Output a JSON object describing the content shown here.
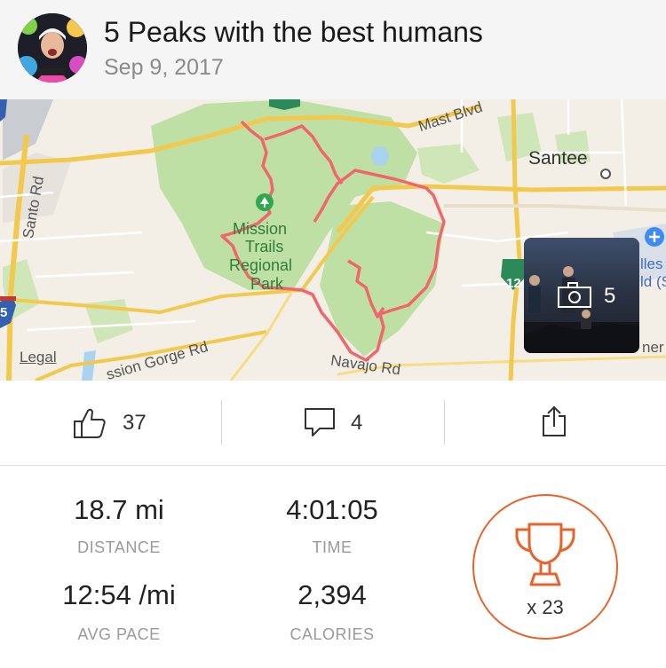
{
  "activity": {
    "title": "5 Peaks with the best humans",
    "date": "Sep 9, 2017"
  },
  "map": {
    "labels": {
      "mast_blvd": "Mast Blvd",
      "santee": "Santee",
      "santo_rd": "Santo Rd",
      "park_line1": "Mission",
      "park_line2": "Trails",
      "park_line3": "Regional",
      "park_line4": "Park",
      "gorge_rd": "ssion Gorge Rd",
      "navajo_rd": "Navajo Rd",
      "right_edge1": "lles",
      "right_edge2": "ld (S",
      "right_edge3": "ner",
      "highway_12": "12",
      "highway_5": "5",
      "legal": "Legal"
    },
    "route_color": "#f0666a",
    "park_color": "#bfe0a5"
  },
  "photos": {
    "count": "5"
  },
  "social": {
    "kudos": "37",
    "comments": "4"
  },
  "stats": {
    "distance": {
      "value": "18.7 mi",
      "label": "DISTANCE"
    },
    "time": {
      "value": "4:01:05",
      "label": "TIME"
    },
    "pace": {
      "value": "12:54 /mi",
      "label": "AVG PACE"
    },
    "calories": {
      "value": "2,394",
      "label": "CALORIES"
    }
  },
  "achievements": {
    "count": "x 23"
  },
  "colors": {
    "accent": "#e8632b"
  }
}
